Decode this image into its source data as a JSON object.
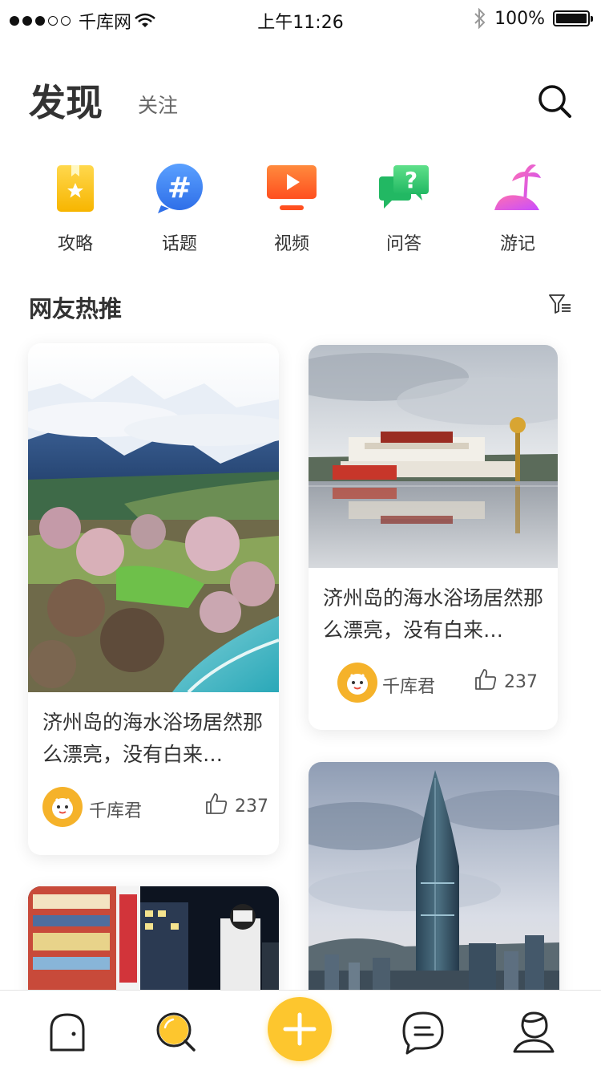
{
  "status": {
    "carrier": "千库网",
    "time": "上午11:26",
    "battery": "100%"
  },
  "header": {
    "title": "发现",
    "follow_tab": "关注"
  },
  "categories": [
    {
      "label": "攻略",
      "icon": "guide-bookmark-icon"
    },
    {
      "label": "话题",
      "icon": "topic-hash-icon"
    },
    {
      "label": "视频",
      "icon": "video-play-icon"
    },
    {
      "label": "问答",
      "icon": "qa-question-icon"
    },
    {
      "label": "游记",
      "icon": "travel-palm-icon"
    }
  ],
  "section": {
    "title": "网友热推"
  },
  "cards": [
    {
      "text": "济州岛的海水浴场居然那么漂亮，没有白来…",
      "author": "千库君",
      "likes": "237",
      "image": "snow-mountain-valley"
    },
    {
      "text": "济州岛的海水浴场居然那么漂亮，没有白来…",
      "author": "千库君",
      "likes": "237",
      "image": "palace-reflection"
    },
    {
      "image": "city-street-night"
    },
    {
      "image": "skyscraper-skyline"
    }
  ],
  "colors": {
    "accent": "#fdc62e",
    "text": "#333333",
    "muted": "#666666"
  }
}
